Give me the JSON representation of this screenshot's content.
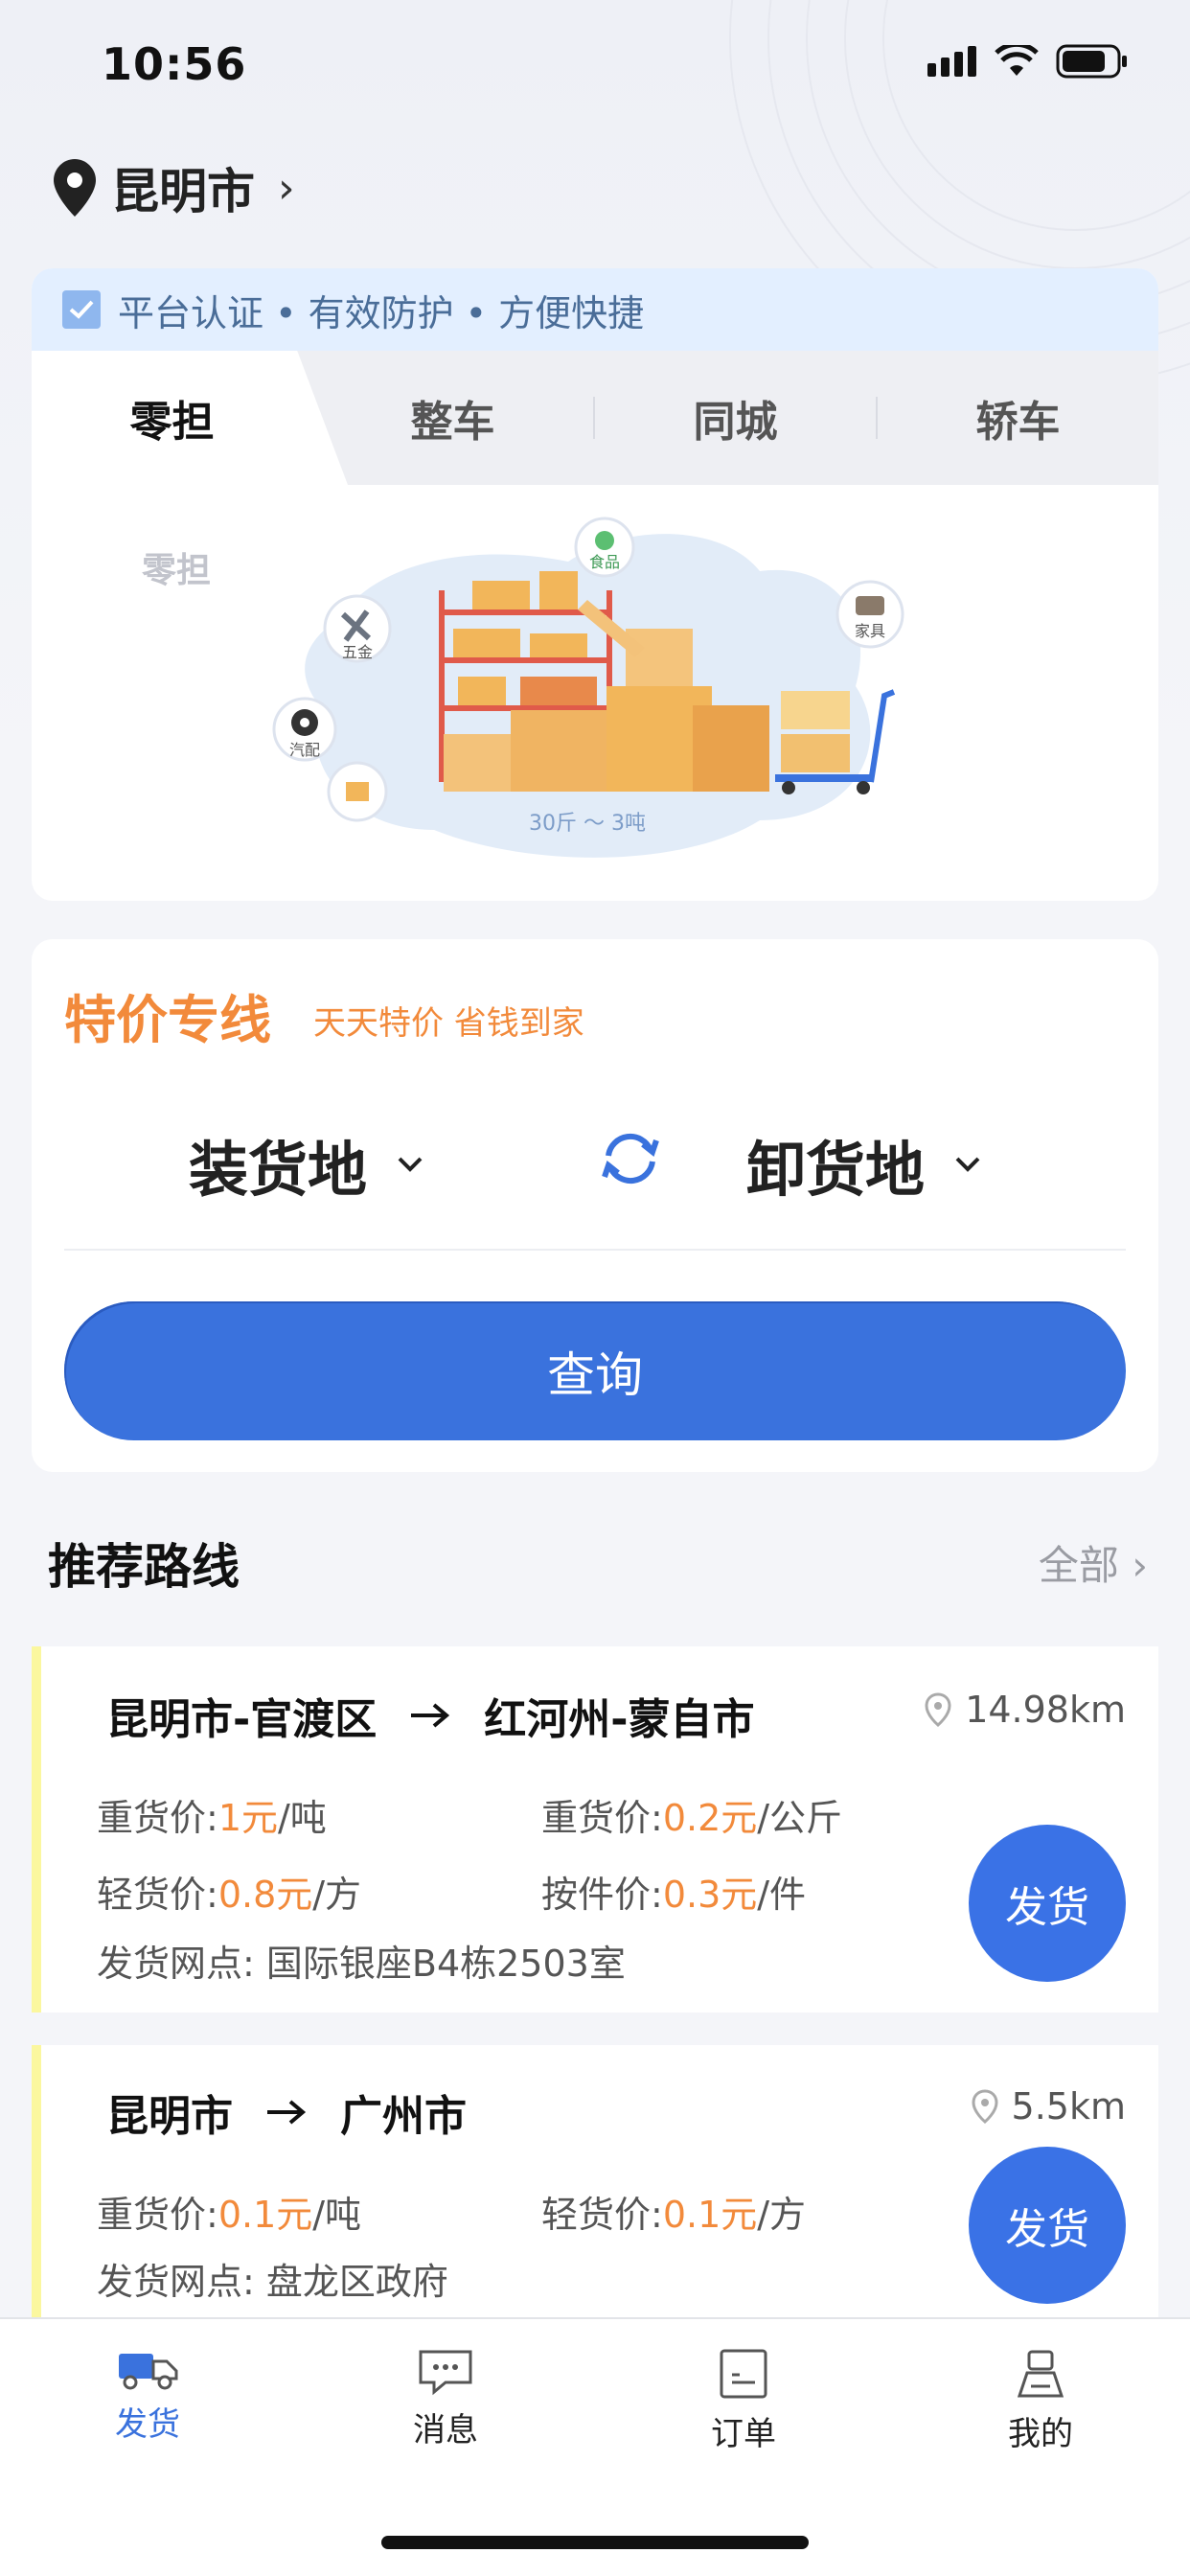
{
  "status_bar": {
    "time": "10:56"
  },
  "location": {
    "city": "昆明市",
    "chevron": "›"
  },
  "certification": {
    "text": "平台认证 • 有效防护 • 方便快捷"
  },
  "tabs": [
    {
      "label": "零担",
      "active": true
    },
    {
      "label": "整车",
      "active": false
    },
    {
      "label": "同城",
      "active": false
    },
    {
      "label": "轿车",
      "active": false
    }
  ],
  "hero": {
    "label": "零担",
    "weight_range": "30斤 ～ 3吨",
    "badges": [
      "五金",
      "汽配",
      "食品",
      "家具"
    ]
  },
  "special_line": {
    "title": "特价专线",
    "subtitle": "天天特价 省钱到家",
    "origin_label": "装货地",
    "destination_label": "卸货地",
    "query_label": "查询"
  },
  "recommend": {
    "title": "推荐路线",
    "all_label": "全部 ›"
  },
  "routes": [
    {
      "from": "昆明市-官渡区",
      "to": "红河州-蒙自市",
      "distance": "14.98km",
      "prices": [
        {
          "label": "重货价:",
          "value": "1元",
          "unit": "/吨"
        },
        {
          "label": "重货价:",
          "value": "0.2元",
          "unit": "/公斤"
        },
        {
          "label": "轻货价:",
          "value": "0.8元",
          "unit": "/方"
        },
        {
          "label": "按件价:",
          "value": "0.3元",
          "unit": "/件"
        }
      ],
      "outlet": "发货网点: 国际银座B4栋2503室",
      "button": "发货"
    },
    {
      "from": "昆明市",
      "to": "广州市",
      "distance": "5.5km",
      "prices": [
        {
          "label": "重货价:",
          "value": "0.1元",
          "unit": "/吨"
        },
        {
          "label": "轻货价:",
          "value": "0.1元",
          "unit": "/方"
        }
      ],
      "outlet": "发货网点: 盘龙区政府",
      "button": "发货"
    }
  ],
  "tabbar": [
    {
      "label": "发货",
      "icon": "truck-icon",
      "active": true
    },
    {
      "label": "消息",
      "icon": "message-icon",
      "active": false
    },
    {
      "label": "订单",
      "icon": "order-icon",
      "active": false
    },
    {
      "label": "我的",
      "icon": "profile-icon",
      "active": false
    }
  ],
  "colors": {
    "accent": "#3a72dd",
    "orange": "#f28a3b",
    "cert_bg": "#e3efff",
    "route_stripe": "#fbf79f"
  }
}
